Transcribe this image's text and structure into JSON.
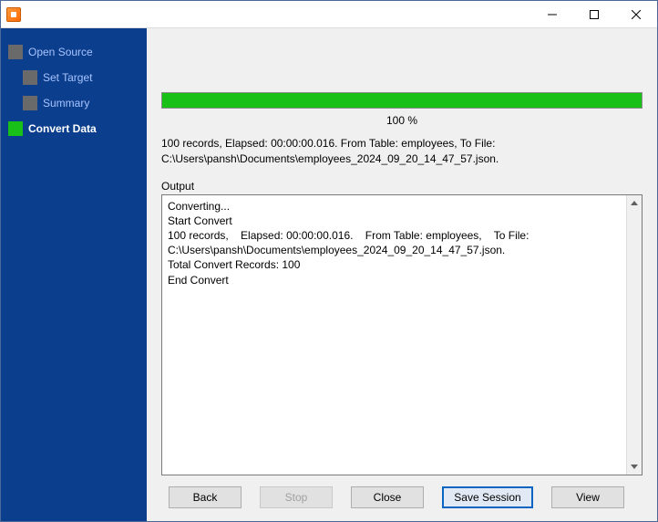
{
  "titlebar": {
    "title": ""
  },
  "sidebar": {
    "items": [
      {
        "label": "Open Source"
      },
      {
        "label": "Set Target"
      },
      {
        "label": "Summary"
      },
      {
        "label": "Convert Data"
      }
    ]
  },
  "progress": {
    "percent_label": "100 %",
    "percent_value": 100
  },
  "status": {
    "line": "100 records,    Elapsed: 00:00:00.016.    From Table: employees,    To File: C:\\Users\\pansh\\Documents\\employees_2024_09_20_14_47_57.json."
  },
  "output": {
    "label": "Output",
    "text": "Converting...\nStart Convert\n100 records,    Elapsed: 00:00:00.016.    From Table: employees,    To File: C:\\Users\\pansh\\Documents\\employees_2024_09_20_14_47_57.json.\nTotal Convert Records: 100\nEnd Convert"
  },
  "buttons": {
    "back": "Back",
    "stop": "Stop",
    "close": "Close",
    "save_session": "Save Session",
    "view": "View"
  }
}
